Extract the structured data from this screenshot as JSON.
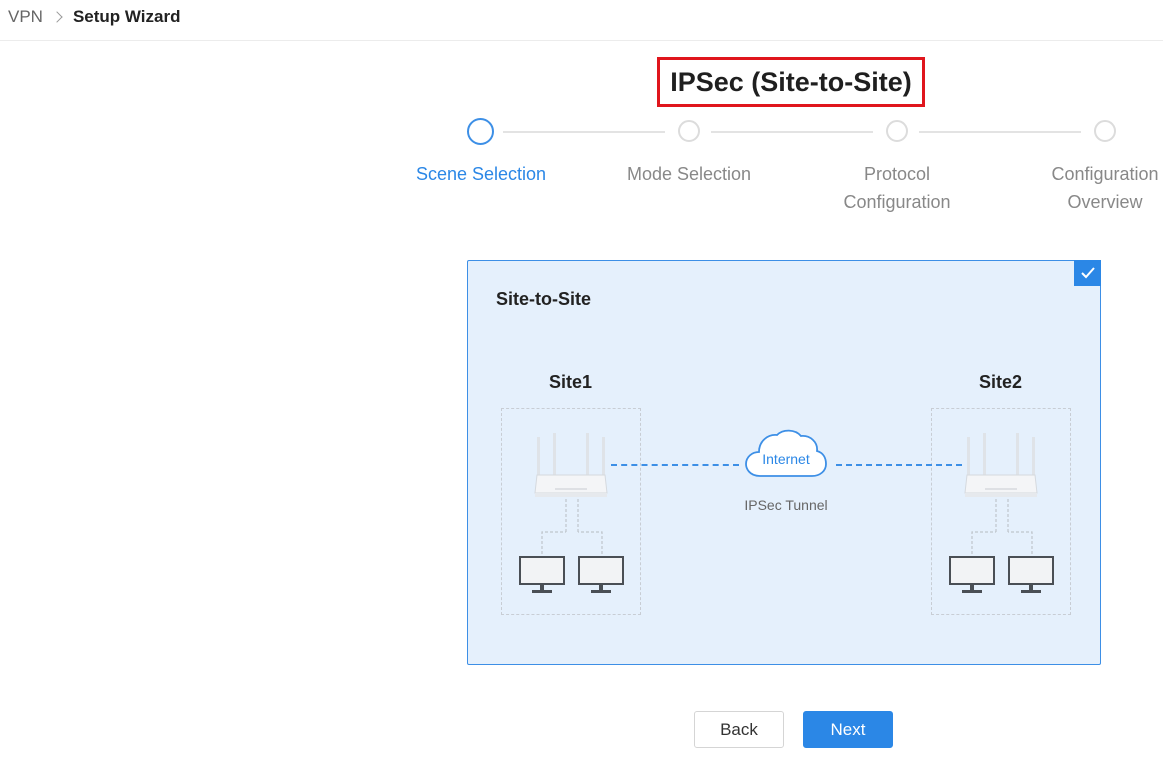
{
  "breadcrumb": {
    "root": "VPN",
    "current": "Setup Wizard"
  },
  "page": {
    "title": "IPSec (Site-to-Site)"
  },
  "steps": [
    {
      "line1": "Scene Selection",
      "line2": "",
      "active": true
    },
    {
      "line1": "Mode Selection",
      "line2": "",
      "active": false
    },
    {
      "line1": "Protocol",
      "line2": "Configuration",
      "active": false
    },
    {
      "line1": "Configuration",
      "line2": "Overview",
      "active": false
    }
  ],
  "scene_card": {
    "title": "Site-to-Site",
    "selected": true,
    "site1_label": "Site1",
    "site2_label": "Site2",
    "cloud_label": "Internet",
    "tunnel_label": "IPSec Tunnel"
  },
  "buttons": {
    "back": "Back",
    "next": "Next"
  },
  "colors": {
    "accent": "#2b87e6",
    "highlight_border": "#e0161d",
    "card_bg": "#e5f0fc"
  }
}
